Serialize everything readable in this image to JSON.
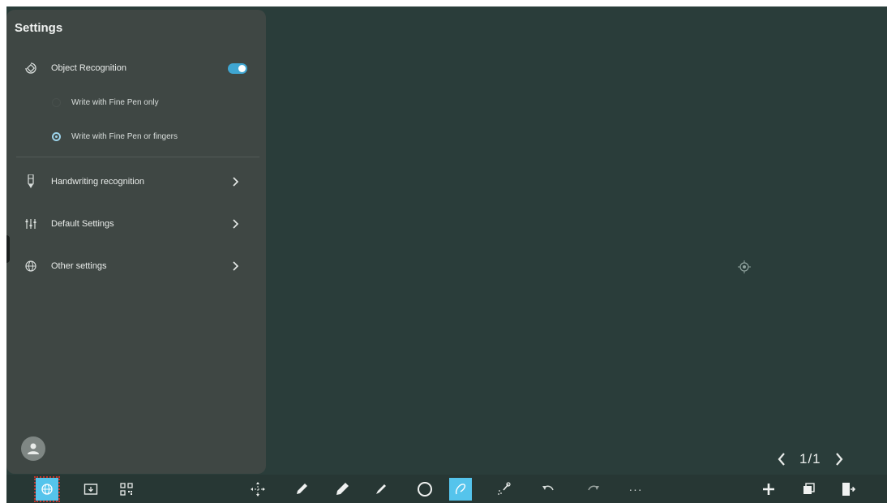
{
  "settings": {
    "title": "Settings",
    "object_recognition": {
      "label": "Object Recognition",
      "enabled": true
    },
    "options": [
      {
        "label": "Write with Fine Pen only",
        "selected": false
      },
      {
        "label": "Write with Fine Pen or fingers",
        "selected": true
      }
    ],
    "menu": [
      {
        "label": "Handwriting recognition",
        "icon": "pen-icon"
      },
      {
        "label": "Default Settings",
        "icon": "sliders-icon"
      },
      {
        "label": "Other settings",
        "icon": "globe-icon"
      }
    ]
  },
  "pager": {
    "text": "1/1"
  },
  "toolbar": {
    "left": [
      "settings-icon",
      "folder-icon",
      "qr-code-icon"
    ],
    "center": [
      "move-select-icon",
      "fine-pen-icon",
      "marker-pen-icon",
      "brush-pen-icon",
      "circle-eraser-icon",
      "lasso-icon",
      "laser-pointer-icon",
      "undo-icon",
      "redo-icon",
      "more-icon"
    ],
    "right": [
      "add-page-icon",
      "pages-icon",
      "exit-icon"
    ],
    "active_tool": "lasso-icon",
    "more_label": "···"
  },
  "colors": {
    "board": "#2a3d3a",
    "panel": "#3f4744",
    "accent": "#55c4ec"
  }
}
